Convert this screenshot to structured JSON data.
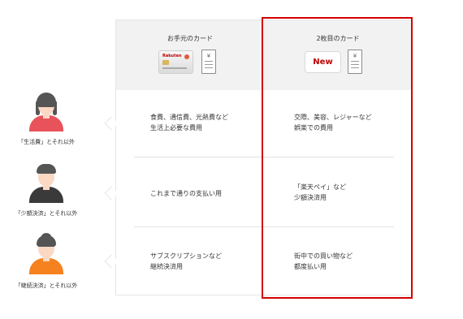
{
  "header": {
    "left_title": "お手元のカード",
    "right_title": "2枚目のカード",
    "new_badge": "New",
    "card_brand": "Rakuten",
    "receipt_symbol": "¥"
  },
  "rows": [
    {
      "person_label": "「生活費」とそれ以外",
      "left": [
        "食費、通信費、光熱費など",
        "生活上必要な費用"
      ],
      "right": [
        "交際、美容、レジャーなど",
        "娯楽での費用"
      ]
    },
    {
      "person_label": "「少額決済」とそれ以外",
      "left": [
        "これまで通りの支払い用"
      ],
      "right": [
        "「楽天ペイ」など",
        "少額決済用"
      ]
    },
    {
      "person_label": "「継続決済」とそれ以外",
      "left": [
        "サブスクリプションなど",
        "継続決済用"
      ],
      "right": [
        "街中での買い物など",
        "都度払い用"
      ]
    }
  ],
  "colors": {
    "highlight": "#d40000",
    "person1_shirt": "#e8525a",
    "person2_shirt": "#3a3a3a",
    "person3_shirt": "#f5821f"
  }
}
